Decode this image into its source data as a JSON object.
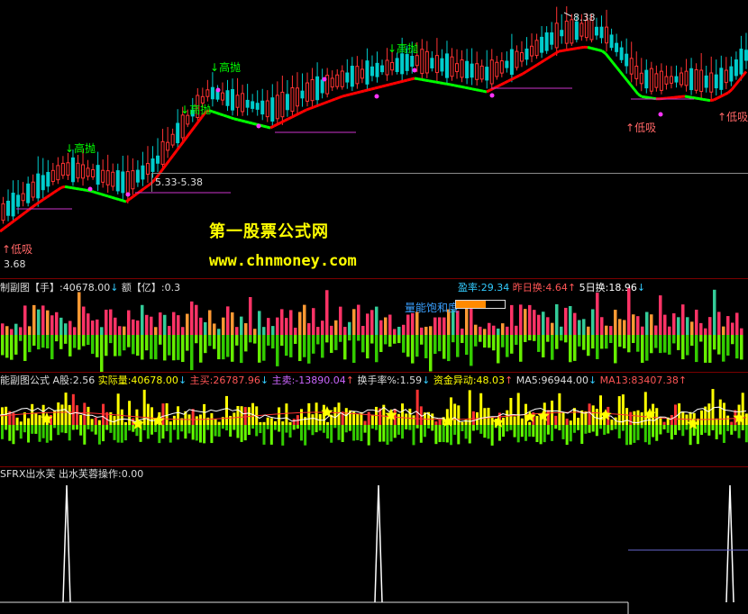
{
  "watermark": {
    "title": "第一股票公式网",
    "url": "www.chnmoney.com"
  },
  "main_chart": {
    "range_label": "5.33-5.38",
    "high_price": "8.38",
    "low_price": "3.68",
    "signals": [
      {
        "label": "高抛",
        "kind": "sell"
      },
      {
        "label": "高抛",
        "kind": "sell"
      },
      {
        "label": "高抛",
        "kind": "sell"
      },
      {
        "label": "高抛",
        "kind": "sell"
      },
      {
        "label": "低吸",
        "kind": "buy"
      },
      {
        "label": "低吸",
        "kind": "buy"
      },
      {
        "label": "低吸",
        "kind": "buy"
      }
    ]
  },
  "volume_panel": {
    "header": [
      {
        "text": "制副图",
        "color": "#dddddd"
      },
      {
        "text": "【手】:40678.00",
        "color": "#dddddd"
      },
      {
        "text": "↓",
        "color": "#33ccff"
      },
      {
        "text": "  额【亿】:0.3",
        "color": "#dddddd"
      }
    ],
    "header_right": [
      {
        "text": "盈率:29.34",
        "color": "#33ccff"
      },
      {
        "text": " 昨日换:4.64",
        "color": "#ff5555"
      },
      {
        "text": "↑",
        "color": "#ff5555"
      },
      {
        "text": "  5日换:18.96",
        "color": "#ffffff"
      },
      {
        "text": "↓",
        "color": "#33ccff"
      }
    ],
    "saturation_label": "量能饱和度",
    "saturation_level": 0.62
  },
  "energy_panel": {
    "header": [
      {
        "text": "能副图公式",
        "color": "#dddddd"
      },
      {
        "text": "  A股:2.56",
        "color": "#dddddd"
      },
      {
        "text": "  实际量:40678.00",
        "color": "#ffff00"
      },
      {
        "text": "↓",
        "color": "#33ccff"
      },
      {
        "text": "  主买:26787.96",
        "color": "#ff5555"
      },
      {
        "text": "↓",
        "color": "#33ccff"
      },
      {
        "text": "  主卖:-13890.04",
        "color": "#cc66ff"
      },
      {
        "text": "↑",
        "color": "#ff5555"
      },
      {
        "text": "  换手率%:1.59",
        "color": "#dddddd"
      },
      {
        "text": "↓",
        "color": "#33ccff"
      },
      {
        "text": "    资金异动:48.03",
        "color": "#ffff00"
      },
      {
        "text": "↑",
        "color": "#ff5555"
      },
      {
        "text": "  MA5:96944.00",
        "color": "#dddddd"
      },
      {
        "text": "↓",
        "color": "#33ccff"
      },
      {
        "text": "  MA13:83407.38",
        "color": "#ff5555"
      },
      {
        "text": "↑",
        "color": "#ff5555"
      }
    ]
  },
  "signal_panel": {
    "header": [
      {
        "text": "SFRX出水芙",
        "color": "#dddddd"
      },
      {
        "text": "  出水芙蓉操作:0.00",
        "color": "#dddddd"
      }
    ]
  },
  "colors": {
    "up": "#ff3333",
    "down": "#00cccc",
    "ma_up": "#ff0000",
    "ma_down": "#00ff00",
    "volume_pos": "#ff3366",
    "volume_neg": "#33cc00",
    "energy_up": "#ffff00"
  }
}
